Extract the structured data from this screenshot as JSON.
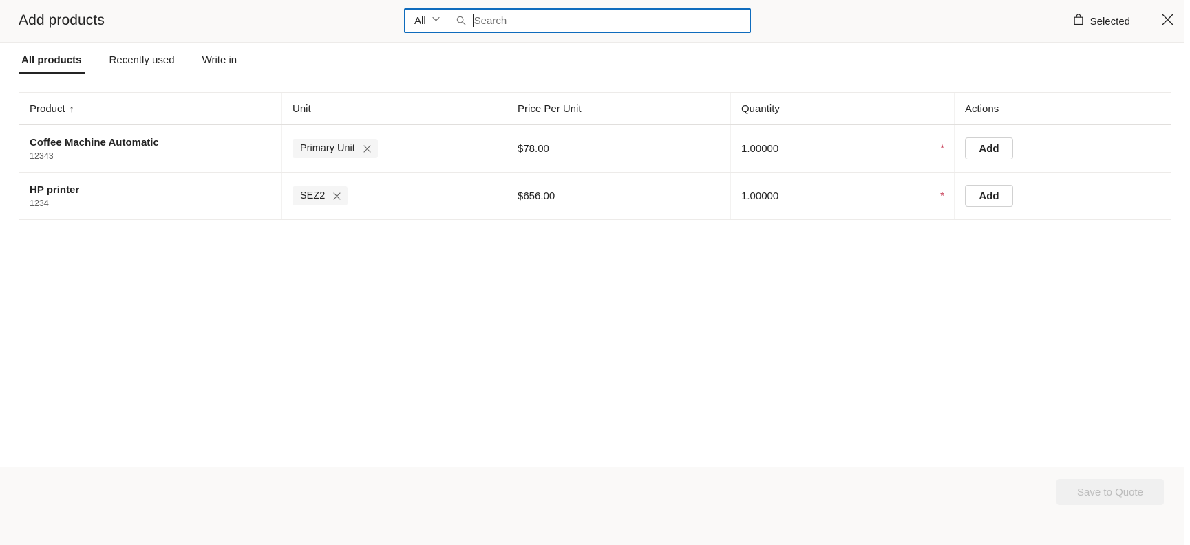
{
  "header": {
    "title": "Add products",
    "search": {
      "scope_selected": "All",
      "scope_icon": "chevron-down-icon",
      "magnifier_icon": "search-icon",
      "placeholder": "Search",
      "value": ""
    },
    "selected_button": {
      "label": "Selected",
      "icon": "shopping-bag-icon"
    },
    "close_icon": "close-icon"
  },
  "tabs": [
    {
      "label": "All products",
      "active": true
    },
    {
      "label": "Recently used",
      "active": false
    },
    {
      "label": "Write in",
      "active": false
    }
  ],
  "table": {
    "columns": [
      {
        "label": "Product",
        "sort_indicator": "↑"
      },
      {
        "label": "Unit",
        "sort_indicator": ""
      },
      {
        "label": "Price Per Unit",
        "sort_indicator": ""
      },
      {
        "label": "Quantity",
        "sort_indicator": ""
      },
      {
        "label": "Actions",
        "sort_indicator": ""
      }
    ],
    "rows": [
      {
        "product_name": "Coffee Machine Automatic",
        "product_id": "12343",
        "unit_chip": "Primary Unit",
        "unit_chip_remove_icon": "close-icon",
        "price_per_unit": "$78.00",
        "quantity": "1.00000",
        "quantity_required_marker": "*",
        "action_label": "Add"
      },
      {
        "product_name": "HP printer",
        "product_id": "1234",
        "unit_chip": "SEZ2",
        "unit_chip_remove_icon": "close-icon",
        "price_per_unit": "$656.00",
        "quantity": "1.00000",
        "quantity_required_marker": "*",
        "action_label": "Add"
      }
    ]
  },
  "footer": {
    "save_label": "Save to Quote",
    "save_disabled": true
  },
  "colors": {
    "accent": "#0f6cbd",
    "required": "#c4314b",
    "header_bg": "#faf9f8",
    "border": "#edebe9",
    "text": "#242424",
    "muted_text": "#616161",
    "chip_bg": "#f5f5f5",
    "disabled_button_bg": "#f0f0f0",
    "disabled_button_text": "#bdbdbd"
  }
}
